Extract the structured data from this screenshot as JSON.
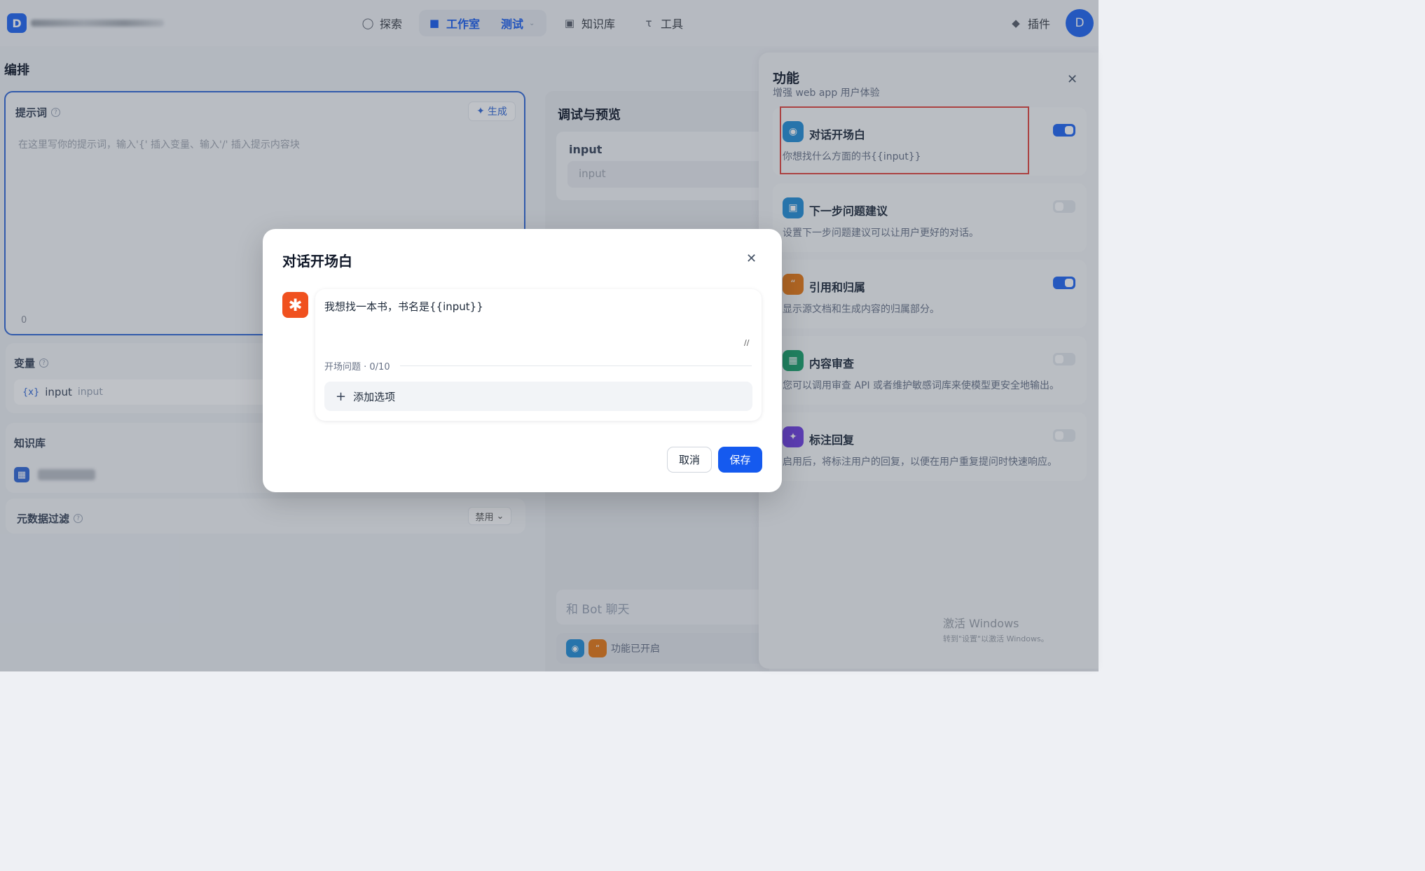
{
  "app": {
    "logo_letter": "D",
    "user_initial": "D"
  },
  "nav": {
    "explore": "探索",
    "studio": "工作室",
    "app_name": "测试",
    "knowledge": "知识库",
    "tools": "工具",
    "plugins": "插件"
  },
  "orchestrate": {
    "title": "编排",
    "prompt": {
      "title": "提示词",
      "generate": "生成",
      "placeholder": "在这里写你的提示词，输入'{' 插入变量、输入'/' 插入提示内容块",
      "count": "0"
    },
    "variables": {
      "title": "变量",
      "name": "input",
      "label": "input"
    },
    "knowledge": {
      "title": "知识库"
    },
    "metadata": {
      "title": "元数据过滤",
      "mode": "禁用"
    }
  },
  "preview": {
    "title": "调试与预览",
    "input_label": "input",
    "input_placeholder": "input",
    "chat_placeholder": "和 Bot 聊天",
    "features_on": "功能已开启"
  },
  "features": {
    "title": "功能",
    "subtitle": "增强 web app 用户体验",
    "items": [
      {
        "name": "对话开场白",
        "desc": "你想找什么方面的书{{input}}",
        "enabled": true,
        "color": "#1f8dd6"
      },
      {
        "name": "下一步问题建议",
        "desc": "设置下一步问题建议可以让用户更好的对话。",
        "enabled": false,
        "color": "#1f8dd6"
      },
      {
        "name": "引用和归属",
        "desc": "显示源文档和生成内容的归属部分。",
        "enabled": true,
        "color": "#e8770f"
      },
      {
        "name": "内容审查",
        "desc": "您可以调用审查 API 或者维护敏感词库来使模型更安全地输出。",
        "enabled": false,
        "color": "#16a067"
      },
      {
        "name": "标注回复",
        "desc": "启用后，将标注用户的回复，以便在用户重复提问时快速响应。",
        "enabled": false,
        "color": "#6d3ce0"
      }
    ]
  },
  "modal": {
    "title": "对话开场白",
    "message": "我想找一本书，书名是{{input}}",
    "questions_label": "开场问题 · 0/10",
    "add_option": "添加选项",
    "cancel": "取消",
    "save": "保存"
  },
  "watermark": {
    "line1": "激活 Windows",
    "line2": "转到\"设置\"以激活 Windows。"
  }
}
